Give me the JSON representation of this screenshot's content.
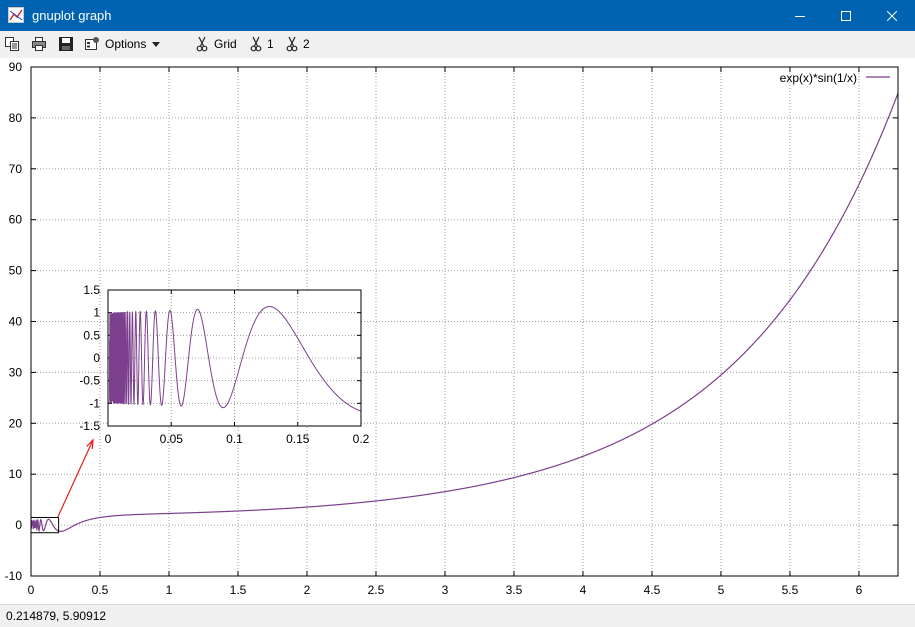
{
  "window": {
    "title": "gnuplot graph"
  },
  "toolbar": {
    "options_label": "Options",
    "grid_label": "Grid",
    "plot1_label": "1",
    "plot2_label": "2"
  },
  "status": {
    "coords": "0.214879,  5.90912"
  },
  "colors": {
    "titlebar": "#0063b1",
    "series": "#7c3f8e",
    "arrow": "#e0201b"
  },
  "chart_data": [
    {
      "type": "line",
      "role": "main",
      "function": "exp(x)*sin(1/x)",
      "series": [
        {
          "name": "exp(x)*sin(1/x)"
        }
      ],
      "xlim": [
        0,
        6.283
      ],
      "ylim": [
        -10,
        90
      ],
      "xticks": [
        "0",
        "0.5",
        "1",
        "1.5",
        "2",
        "2.5",
        "3",
        "3.5",
        "4",
        "4.5",
        "5",
        "5.5",
        "6"
      ],
      "xtick_values": [
        0,
        0.5,
        1,
        1.5,
        2,
        2.5,
        3,
        3.5,
        4,
        4.5,
        5,
        5.5,
        6
      ],
      "yticks": [
        "-10",
        "0",
        "10",
        "20",
        "30",
        "40",
        "50",
        "60",
        "70",
        "80",
        "90"
      ],
      "ytick_values": [
        -10,
        0,
        10,
        20,
        30,
        40,
        50,
        60,
        70,
        80,
        90
      ],
      "grid": true,
      "legend": "top-right",
      "zoom_box": {
        "xlim": [
          0,
          0.2
        ],
        "ylim": [
          -1.5,
          1.5
        ]
      }
    },
    {
      "type": "line",
      "role": "inset",
      "function": "exp(x)*sin(1/x)",
      "xlim": [
        0,
        0.2
      ],
      "ylim": [
        -1.5,
        1.5
      ],
      "xticks": [
        "0",
        "0.05",
        "0.1",
        "0.15",
        "0.2"
      ],
      "xtick_values": [
        0,
        0.05,
        0.1,
        0.15,
        0.2
      ],
      "yticks": [
        "-1.5",
        "-1",
        "-0.5",
        "0",
        "0.5",
        "1",
        "1.5"
      ],
      "ytick_values": [
        -1.5,
        -1,
        -0.5,
        0,
        0.5,
        1,
        1.5
      ],
      "grid": true
    }
  ]
}
